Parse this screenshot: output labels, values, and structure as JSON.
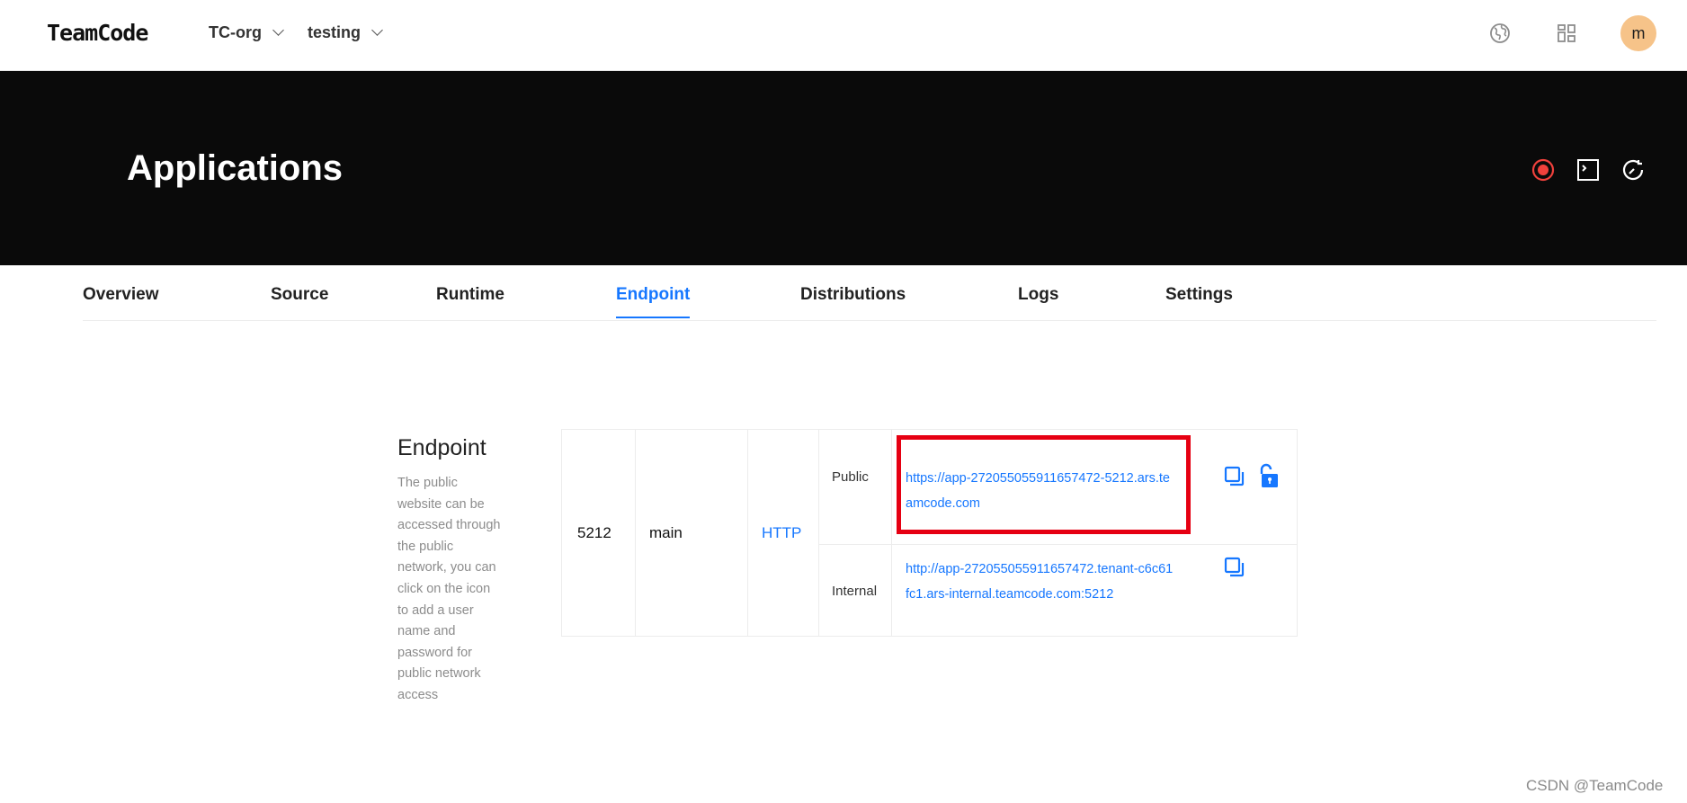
{
  "header": {
    "logo": "TeamCode",
    "org": "TC-org",
    "project": "testing",
    "avatar_initial": "m",
    "icons": [
      "globe-icon",
      "apps-grid-icon"
    ]
  },
  "hero": {
    "title": "Applications",
    "icons": [
      "record-icon",
      "terminal-icon",
      "refresh-icon"
    ],
    "record_color": "#f0413c"
  },
  "tabs": [
    {
      "label": "Overview",
      "active": false
    },
    {
      "label": "Source",
      "active": false
    },
    {
      "label": "Runtime",
      "active": false
    },
    {
      "label": "Endpoint",
      "active": true
    },
    {
      "label": "Distributions",
      "active": false
    },
    {
      "label": "Logs",
      "active": false
    },
    {
      "label": "Settings",
      "active": false
    }
  ],
  "endpoint": {
    "title": "Endpoint",
    "description": "The public website can be accessed through the public network, you can click on the icon to add a user name and password for public network access",
    "port": "5212",
    "name": "main",
    "protocol": "HTTP",
    "public": {
      "label": "Public",
      "url": "https://app-272055055911657472-5212.ars.teamcode.com"
    },
    "internal": {
      "label": "Internal",
      "url": "http://app-272055055911657472.tenant-c6c61fc1.ars-internal.teamcode.com:5212"
    }
  },
  "colors": {
    "accent": "#1677ff",
    "highlight": "#e60012",
    "avatar_bg": "#f6c389"
  },
  "watermark": "CSDN @TeamCode"
}
